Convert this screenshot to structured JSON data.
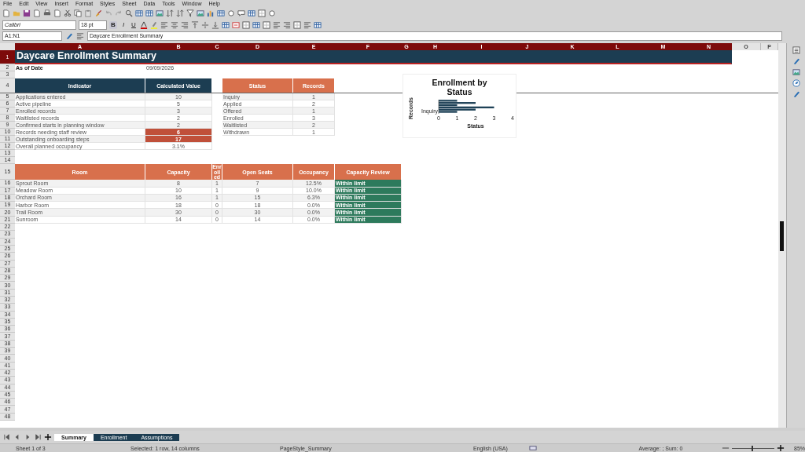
{
  "menu": [
    "File",
    "Edit",
    "View",
    "Insert",
    "Format",
    "Styles",
    "Sheet",
    "Data",
    "Tools",
    "Window",
    "Help"
  ],
  "formatting": {
    "font_name": "Calibri",
    "font_size": "18 pt",
    "bold": "B",
    "italic": "I",
    "underline": "U"
  },
  "formula_bar": {
    "name_box": "A1:N1",
    "content": "Daycare Enrollment Summary"
  },
  "columns": [
    {
      "label": "A",
      "selected": true
    },
    {
      "label": "B",
      "selected": true
    },
    {
      "label": "C",
      "selected": true
    },
    {
      "label": "D",
      "selected": true
    },
    {
      "label": "E",
      "selected": true
    },
    {
      "label": "F",
      "selected": true
    },
    {
      "label": "G",
      "selected": true
    },
    {
      "label": "H",
      "selected": true
    },
    {
      "label": "I",
      "selected": true
    },
    {
      "label": "J",
      "selected": true
    },
    {
      "label": "K",
      "selected": true
    },
    {
      "label": "L",
      "selected": true
    },
    {
      "label": "M",
      "selected": true
    },
    {
      "label": "N",
      "selected": true
    },
    {
      "label": "O",
      "selected": false
    },
    {
      "label": "P",
      "selected": false
    }
  ],
  "row_headers": [
    {
      "label": "1",
      "selected": true
    },
    {
      "label": "2",
      "selected": false
    },
    {
      "label": "3",
      "selected": false
    },
    {
      "label": "4",
      "selected": false
    },
    {
      "label": "5",
      "selected": false
    },
    {
      "label": "6",
      "selected": false
    },
    {
      "label": "7",
      "selected": false
    },
    {
      "label": "8",
      "selected": false
    },
    {
      "label": "9",
      "selected": false
    },
    {
      "label": "10",
      "selected": false
    },
    {
      "label": "11",
      "selected": false
    },
    {
      "label": "12",
      "selected": false
    },
    {
      "label": "13",
      "selected": false
    },
    {
      "label": "14",
      "selected": false
    },
    {
      "label": "15",
      "selected": false
    },
    {
      "label": "16",
      "selected": false
    },
    {
      "label": "17",
      "selected": false
    },
    {
      "label": "18",
      "selected": false
    },
    {
      "label": "19",
      "selected": false
    },
    {
      "label": "20",
      "selected": false
    },
    {
      "label": "21",
      "selected": false
    },
    {
      "label": "22",
      "selected": false
    },
    {
      "label": "23",
      "selected": false
    },
    {
      "label": "24",
      "selected": false
    },
    {
      "label": "25",
      "selected": false
    },
    {
      "label": "26",
      "selected": false
    },
    {
      "label": "27",
      "selected": false
    },
    {
      "label": "28",
      "selected": false
    },
    {
      "label": "29",
      "selected": false
    },
    {
      "label": "30",
      "selected": false
    },
    {
      "label": "31",
      "selected": false
    },
    {
      "label": "32",
      "selected": false
    },
    {
      "label": "33",
      "selected": false
    },
    {
      "label": "34",
      "selected": false
    },
    {
      "label": "35",
      "selected": false
    },
    {
      "label": "36",
      "selected": false
    },
    {
      "label": "37",
      "selected": false
    },
    {
      "label": "38",
      "selected": false
    },
    {
      "label": "39",
      "selected": false
    },
    {
      "label": "40",
      "selected": false
    },
    {
      "label": "41",
      "selected": false
    },
    {
      "label": "42",
      "selected": false
    },
    {
      "label": "43",
      "selected": false
    },
    {
      "label": "44",
      "selected": false
    },
    {
      "label": "45",
      "selected": false
    },
    {
      "label": "46",
      "selected": false
    },
    {
      "label": "47",
      "selected": false
    },
    {
      "label": "48",
      "selected": false
    }
  ],
  "sheet": {
    "title": "Daycare Enrollment Summary",
    "as_of": {
      "label": "As of Date",
      "value": "09/09/2026"
    },
    "indicators": {
      "columns": [
        "Indicator",
        "Calculated Value"
      ],
      "rows": [
        {
          "name": "Applications entered",
          "value": "10",
          "flagged": false
        },
        {
          "name": "Active pipeline",
          "value": "5",
          "flagged": false
        },
        {
          "name": "Enrolled records",
          "value": "3",
          "flagged": false
        },
        {
          "name": "Waitlisted records",
          "value": "2",
          "flagged": false
        },
        {
          "name": "Confirmed starts in planning window",
          "value": "2",
          "flagged": false
        },
        {
          "name": "Records needing staff review",
          "value": "6",
          "flagged": true
        },
        {
          "name": "Outstanding onboarding steps",
          "value": "17",
          "flagged": true
        },
        {
          "name": "Overall planned occupancy",
          "value": "3.1%",
          "flagged": false
        }
      ]
    },
    "status_table": {
      "columns": [
        "Status",
        "Records"
      ],
      "rows": [
        [
          "Inquiry",
          "1"
        ],
        [
          "Applied",
          "2"
        ],
        [
          "Offered",
          "1"
        ],
        [
          "Enrolled",
          "3"
        ],
        [
          "Waitlisted",
          "2"
        ],
        [
          "Withdrawn",
          "1"
        ]
      ]
    },
    "rooms": {
      "columns": [
        "Room",
        "Capacity",
        "Enrolled",
        "Open Seats",
        "Occupancy",
        "Capacity Review"
      ],
      "rows": [
        [
          "Sprout Room",
          "8",
          "1",
          "7",
          "12.5%",
          "Within limit"
        ],
        [
          "Meadow Room",
          "10",
          "1",
          "9",
          "10.0%",
          "Within limit"
        ],
        [
          "Orchard Room",
          "16",
          "1",
          "15",
          "6.3%",
          "Within limit"
        ],
        [
          "Harbor Room",
          "18",
          "0",
          "18",
          "0.0%",
          "Within limit"
        ],
        [
          "Trail Room",
          "30",
          "0",
          "30",
          "0.0%",
          "Within limit"
        ],
        [
          "Sunroom",
          "14",
          "0",
          "14",
          "0.0%",
          "Within limit"
        ]
      ]
    }
  },
  "chart": {
    "chart_data": {
      "type": "bar",
      "orientation": "horizontal",
      "title": "Enrollment by Status",
      "xlabel": "Status",
      "ylabel": "Records",
      "categories": [
        "Inquiry"
      ],
      "series": [
        {
          "color": "#1f4257",
          "values": [
            1
          ]
        },
        {
          "color": "#1f4257",
          "values": [
            2
          ]
        },
        {
          "color": "#1f4257",
          "values": [
            1
          ]
        },
        {
          "color": "#1f4257",
          "values": [
            3
          ]
        },
        {
          "color": "#1f4257",
          "values": [
            2
          ]
        },
        {
          "color": "#1f4257",
          "values": [
            1
          ]
        }
      ],
      "xlim": [
        0,
        4
      ],
      "xticks": [
        0,
        1,
        2,
        3,
        4
      ]
    }
  },
  "sheet_tabs": [
    {
      "label": "Summary",
      "selected": true
    },
    {
      "label": "Enrollment",
      "selected": false
    },
    {
      "label": "Assumptions",
      "selected": false
    }
  ],
  "status_bar": {
    "sheet": "Sheet 1 of 3",
    "selection": "Selected: 1 row, 14 columns",
    "page_style": "PageStyle_Summary",
    "language": "English (USA)",
    "summary": "Average: ; Sum: 0",
    "zoom_slider": {
      "level": 0.45
    },
    "zoom": "85%"
  }
}
